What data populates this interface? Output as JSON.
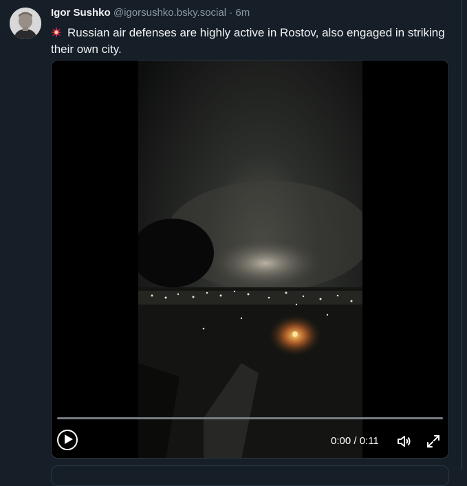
{
  "post": {
    "author_name": "Igor Sushko",
    "handle": "@igorsushko.bsky.social",
    "separator": "·",
    "time_ago": "6m",
    "emoji": "collision-burst",
    "text": "Russian air defenses are highly active in Rostov, also engaged in striking their own city."
  },
  "video": {
    "timecode": "0:00 / 0:11",
    "progress": 0,
    "play_icon": "play-icon",
    "volume_icon": "volume-icon",
    "fullscreen_icon": "fullscreen-icon"
  },
  "colors": {
    "background": "#161e27",
    "secondary_text": "#8b98a5",
    "burst": "#e0245e"
  }
}
